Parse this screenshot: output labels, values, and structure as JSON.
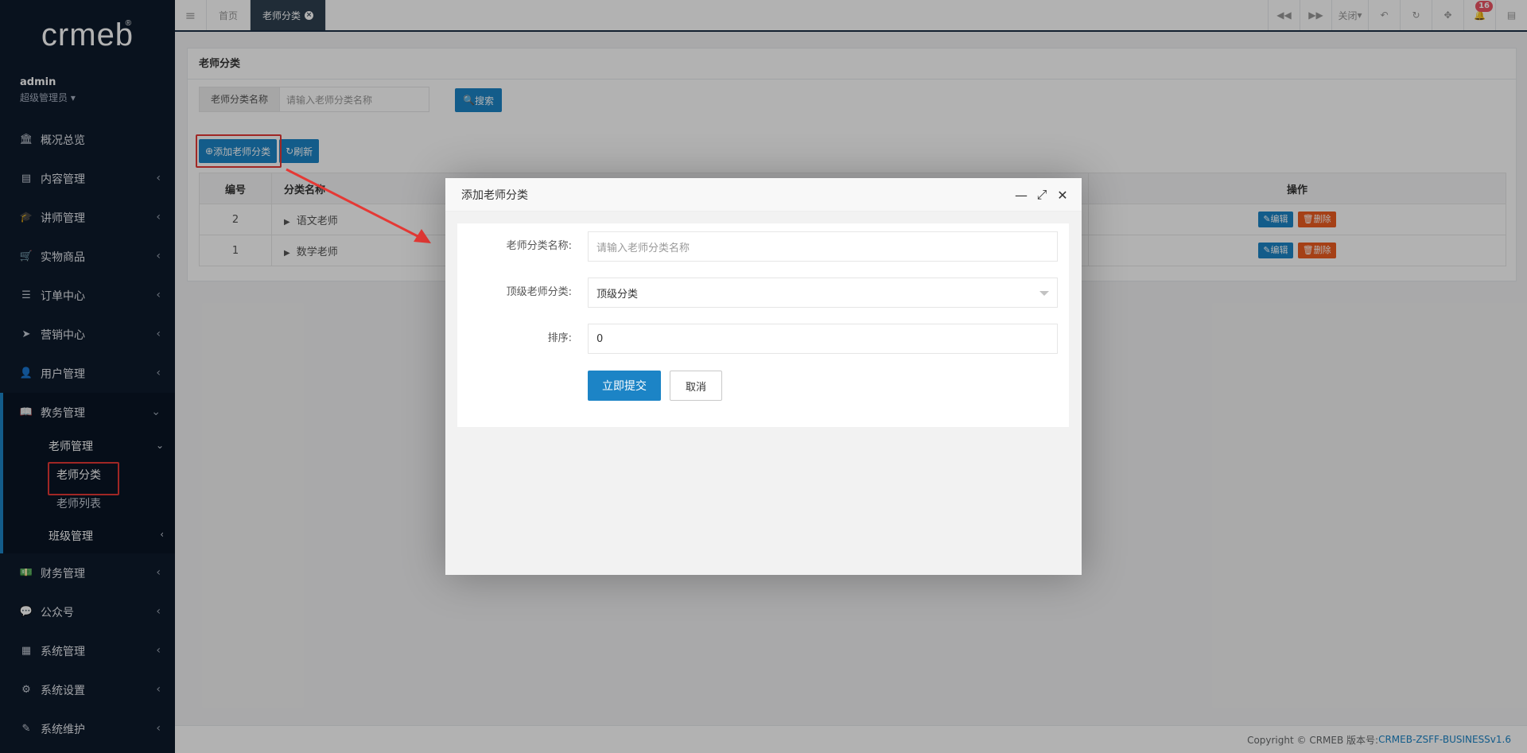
{
  "brand": {
    "logo_text": "crmeb",
    "logo_mark": "®"
  },
  "profile": {
    "name": "admin",
    "role": "超级管理员"
  },
  "sidebar": {
    "items": [
      {
        "label": "概况总览",
        "icon": "bank-icon"
      },
      {
        "label": "内容管理",
        "icon": "newspaper-icon"
      },
      {
        "label": "讲师管理",
        "icon": "graduation-cap-icon"
      },
      {
        "label": "实物商品",
        "icon": "cart-icon"
      },
      {
        "label": "订单中心",
        "icon": "list-icon"
      },
      {
        "label": "营销中心",
        "icon": "paper-plane-icon"
      },
      {
        "label": "用户管理",
        "icon": "user-icon"
      },
      {
        "label": "教务管理",
        "icon": "book-icon"
      },
      {
        "label": "财务管理",
        "icon": "money-icon"
      },
      {
        "label": "公众号",
        "icon": "wechat-icon"
      },
      {
        "label": "系统管理",
        "icon": "grid-icon"
      },
      {
        "label": "系统设置",
        "icon": "gear-icon"
      },
      {
        "label": "系统维护",
        "icon": "wand-icon"
      }
    ],
    "submenu": {
      "group": "老师管理",
      "items": [
        "老师分类",
        "老师列表"
      ],
      "next_group": "班级管理"
    }
  },
  "topbar": {
    "tabs": [
      "首页",
      "老师分类"
    ],
    "close_label": "关闭",
    "notification_count": "16"
  },
  "page": {
    "title": "老师分类",
    "search_label": "老师分类名称",
    "search_placeholder": "请输入老师分类名称",
    "search_button": "搜索",
    "add_button": "添加老师分类",
    "refresh_button": "刷新",
    "columns": [
      "编号",
      "分类名称",
      "操作"
    ],
    "rows": [
      {
        "id": "2",
        "name": "语文老师"
      },
      {
        "id": "1",
        "name": "数学老师"
      }
    ],
    "edit_label": "编辑",
    "delete_label": "删除"
  },
  "modal": {
    "title": "添加老师分类",
    "fields": {
      "name_label": "老师分类名称:",
      "name_placeholder": "请输入老师分类名称",
      "parent_label": "顶级老师分类:",
      "parent_value": "顶级分类",
      "sort_label": "排序:",
      "sort_value": "0"
    },
    "submit": "立即提交",
    "cancel": "取消"
  },
  "footer": {
    "copyright": "Copyright © CRMEB 版本号:",
    "version": "CRMEB-ZSFF-BUSINESSv1.6"
  },
  "colors": {
    "sidebar_bg": "#0e1a2c",
    "accent": "#1c84c6",
    "danger": "#ed5c20",
    "highlight": "#e53935"
  }
}
